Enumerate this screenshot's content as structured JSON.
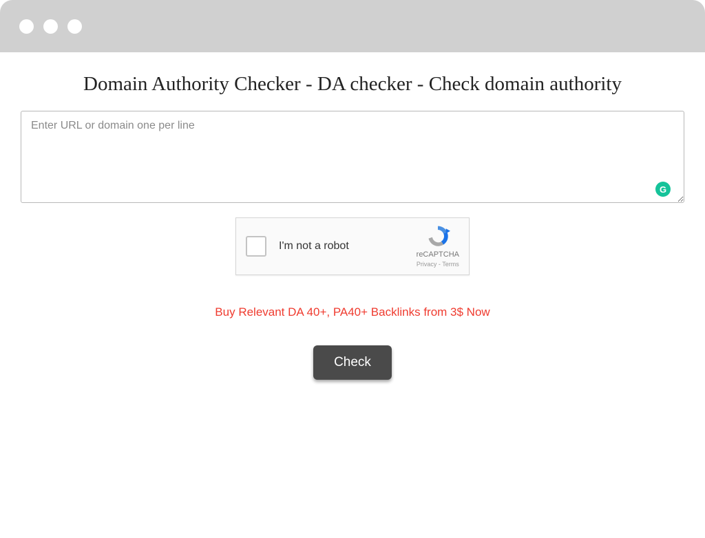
{
  "header": {
    "title": "Domain Authority Checker - DA checker - Check domain authority"
  },
  "input": {
    "placeholder": "Enter URL or domain one per line",
    "value": "",
    "grammarly_badge": "G"
  },
  "recaptcha": {
    "label": "I'm not a robot",
    "brand": "reCAPTCHA",
    "links": "Privacy - Terms"
  },
  "promo": {
    "text": "Buy Relevant DA 40+, PA40+ Backlinks from 3$ Now"
  },
  "actions": {
    "check_label": "Check"
  }
}
